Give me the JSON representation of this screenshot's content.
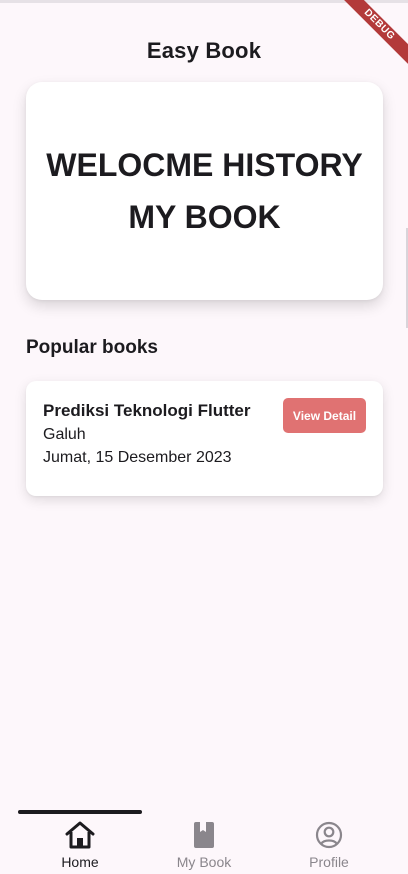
{
  "app": {
    "title": "Easy Book",
    "debug_label": "DEBUG"
  },
  "hero": {
    "text": "WELOCME HISTORY MY BOOK"
  },
  "popular": {
    "heading": "Popular books",
    "books": [
      {
        "title": "Prediksi Teknologi Flutter",
        "author": "Galuh",
        "date": "Jumat, 15 Desember 2023",
        "button_label": "View Detail"
      }
    ]
  },
  "nav": {
    "items": [
      {
        "label": "Home",
        "icon": "home-icon",
        "active": true
      },
      {
        "label": "My Book",
        "icon": "book-icon",
        "active": false
      },
      {
        "label": "Profile",
        "icon": "profile-icon",
        "active": false
      }
    ]
  },
  "colors": {
    "background": "#fdf7fb",
    "button": "#e07272",
    "text": "#1c1b1f",
    "inactive": "#8a868c",
    "debug_ribbon": "#b33a3a"
  }
}
